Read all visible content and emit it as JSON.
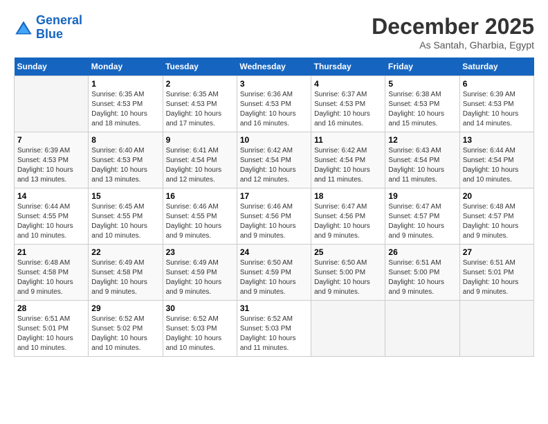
{
  "header": {
    "logo_line1": "General",
    "logo_line2": "Blue",
    "month": "December 2025",
    "location": "As Santah, Gharbia, Egypt"
  },
  "days_of_week": [
    "Sunday",
    "Monday",
    "Tuesday",
    "Wednesday",
    "Thursday",
    "Friday",
    "Saturday"
  ],
  "weeks": [
    [
      {
        "num": "",
        "sunrise": "",
        "sunset": "",
        "daylight": ""
      },
      {
        "num": "1",
        "sunrise": "Sunrise: 6:35 AM",
        "sunset": "Sunset: 4:53 PM",
        "daylight": "Daylight: 10 hours and 18 minutes."
      },
      {
        "num": "2",
        "sunrise": "Sunrise: 6:35 AM",
        "sunset": "Sunset: 4:53 PM",
        "daylight": "Daylight: 10 hours and 17 minutes."
      },
      {
        "num": "3",
        "sunrise": "Sunrise: 6:36 AM",
        "sunset": "Sunset: 4:53 PM",
        "daylight": "Daylight: 10 hours and 16 minutes."
      },
      {
        "num": "4",
        "sunrise": "Sunrise: 6:37 AM",
        "sunset": "Sunset: 4:53 PM",
        "daylight": "Daylight: 10 hours and 16 minutes."
      },
      {
        "num": "5",
        "sunrise": "Sunrise: 6:38 AM",
        "sunset": "Sunset: 4:53 PM",
        "daylight": "Daylight: 10 hours and 15 minutes."
      },
      {
        "num": "6",
        "sunrise": "Sunrise: 6:39 AM",
        "sunset": "Sunset: 4:53 PM",
        "daylight": "Daylight: 10 hours and 14 minutes."
      }
    ],
    [
      {
        "num": "7",
        "sunrise": "Sunrise: 6:39 AM",
        "sunset": "Sunset: 4:53 PM",
        "daylight": "Daylight: 10 hours and 13 minutes."
      },
      {
        "num": "8",
        "sunrise": "Sunrise: 6:40 AM",
        "sunset": "Sunset: 4:53 PM",
        "daylight": "Daylight: 10 hours and 13 minutes."
      },
      {
        "num": "9",
        "sunrise": "Sunrise: 6:41 AM",
        "sunset": "Sunset: 4:54 PM",
        "daylight": "Daylight: 10 hours and 12 minutes."
      },
      {
        "num": "10",
        "sunrise": "Sunrise: 6:42 AM",
        "sunset": "Sunset: 4:54 PM",
        "daylight": "Daylight: 10 hours and 12 minutes."
      },
      {
        "num": "11",
        "sunrise": "Sunrise: 6:42 AM",
        "sunset": "Sunset: 4:54 PM",
        "daylight": "Daylight: 10 hours and 11 minutes."
      },
      {
        "num": "12",
        "sunrise": "Sunrise: 6:43 AM",
        "sunset": "Sunset: 4:54 PM",
        "daylight": "Daylight: 10 hours and 11 minutes."
      },
      {
        "num": "13",
        "sunrise": "Sunrise: 6:44 AM",
        "sunset": "Sunset: 4:54 PM",
        "daylight": "Daylight: 10 hours and 10 minutes."
      }
    ],
    [
      {
        "num": "14",
        "sunrise": "Sunrise: 6:44 AM",
        "sunset": "Sunset: 4:55 PM",
        "daylight": "Daylight: 10 hours and 10 minutes."
      },
      {
        "num": "15",
        "sunrise": "Sunrise: 6:45 AM",
        "sunset": "Sunset: 4:55 PM",
        "daylight": "Daylight: 10 hours and 10 minutes."
      },
      {
        "num": "16",
        "sunrise": "Sunrise: 6:46 AM",
        "sunset": "Sunset: 4:55 PM",
        "daylight": "Daylight: 10 hours and 9 minutes."
      },
      {
        "num": "17",
        "sunrise": "Sunrise: 6:46 AM",
        "sunset": "Sunset: 4:56 PM",
        "daylight": "Daylight: 10 hours and 9 minutes."
      },
      {
        "num": "18",
        "sunrise": "Sunrise: 6:47 AM",
        "sunset": "Sunset: 4:56 PM",
        "daylight": "Daylight: 10 hours and 9 minutes."
      },
      {
        "num": "19",
        "sunrise": "Sunrise: 6:47 AM",
        "sunset": "Sunset: 4:57 PM",
        "daylight": "Daylight: 10 hours and 9 minutes."
      },
      {
        "num": "20",
        "sunrise": "Sunrise: 6:48 AM",
        "sunset": "Sunset: 4:57 PM",
        "daylight": "Daylight: 10 hours and 9 minutes."
      }
    ],
    [
      {
        "num": "21",
        "sunrise": "Sunrise: 6:48 AM",
        "sunset": "Sunset: 4:58 PM",
        "daylight": "Daylight: 10 hours and 9 minutes."
      },
      {
        "num": "22",
        "sunrise": "Sunrise: 6:49 AM",
        "sunset": "Sunset: 4:58 PM",
        "daylight": "Daylight: 10 hours and 9 minutes."
      },
      {
        "num": "23",
        "sunrise": "Sunrise: 6:49 AM",
        "sunset": "Sunset: 4:59 PM",
        "daylight": "Daylight: 10 hours and 9 minutes."
      },
      {
        "num": "24",
        "sunrise": "Sunrise: 6:50 AM",
        "sunset": "Sunset: 4:59 PM",
        "daylight": "Daylight: 10 hours and 9 minutes."
      },
      {
        "num": "25",
        "sunrise": "Sunrise: 6:50 AM",
        "sunset": "Sunset: 5:00 PM",
        "daylight": "Daylight: 10 hours and 9 minutes."
      },
      {
        "num": "26",
        "sunrise": "Sunrise: 6:51 AM",
        "sunset": "Sunset: 5:00 PM",
        "daylight": "Daylight: 10 hours and 9 minutes."
      },
      {
        "num": "27",
        "sunrise": "Sunrise: 6:51 AM",
        "sunset": "Sunset: 5:01 PM",
        "daylight": "Daylight: 10 hours and 9 minutes."
      }
    ],
    [
      {
        "num": "28",
        "sunrise": "Sunrise: 6:51 AM",
        "sunset": "Sunset: 5:01 PM",
        "daylight": "Daylight: 10 hours and 10 minutes."
      },
      {
        "num": "29",
        "sunrise": "Sunrise: 6:52 AM",
        "sunset": "Sunset: 5:02 PM",
        "daylight": "Daylight: 10 hours and 10 minutes."
      },
      {
        "num": "30",
        "sunrise": "Sunrise: 6:52 AM",
        "sunset": "Sunset: 5:03 PM",
        "daylight": "Daylight: 10 hours and 10 minutes."
      },
      {
        "num": "31",
        "sunrise": "Sunrise: 6:52 AM",
        "sunset": "Sunset: 5:03 PM",
        "daylight": "Daylight: 10 hours and 11 minutes."
      },
      {
        "num": "",
        "sunrise": "",
        "sunset": "",
        "daylight": ""
      },
      {
        "num": "",
        "sunrise": "",
        "sunset": "",
        "daylight": ""
      },
      {
        "num": "",
        "sunrise": "",
        "sunset": "",
        "daylight": ""
      }
    ]
  ]
}
